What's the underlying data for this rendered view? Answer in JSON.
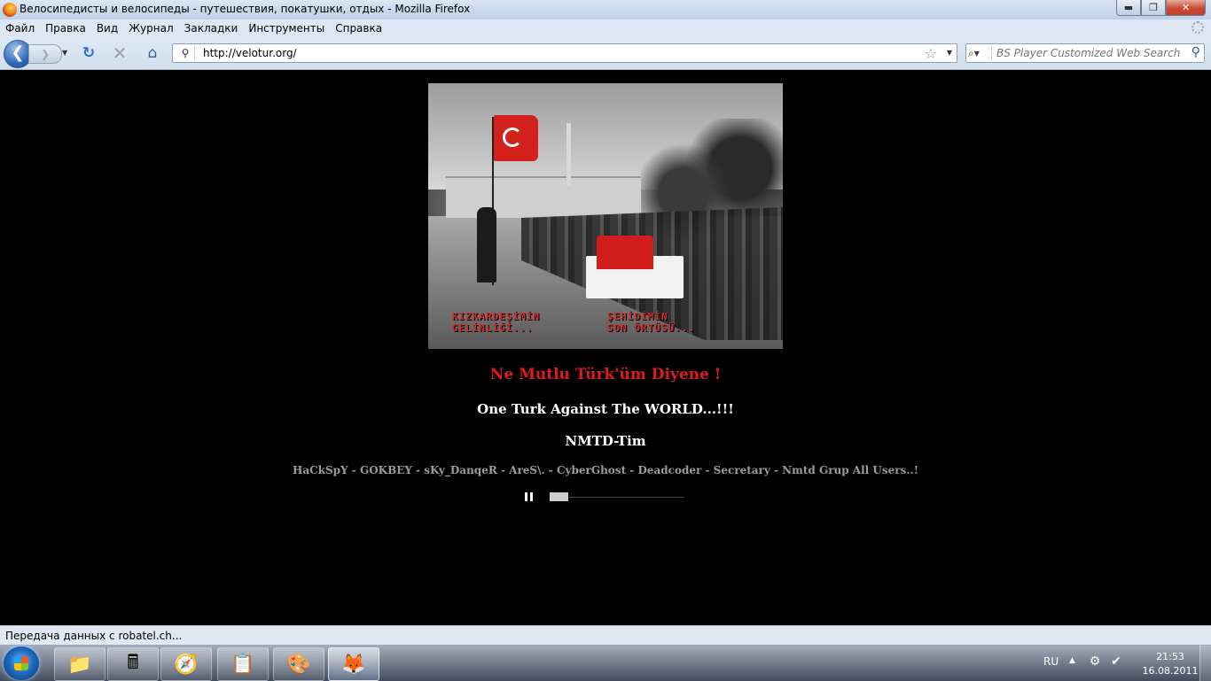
{
  "window": {
    "title": "Велосипедисты и велосипеды - путешествия, покатушки, отдых - Mozilla Firefox",
    "minimize": "▬",
    "maximize": "❐",
    "close": "✕"
  },
  "menu": {
    "items": [
      "Файл",
      "Правка",
      "Вид",
      "Журнал",
      "Закладки",
      "Инструменты",
      "Справка"
    ]
  },
  "toolbar": {
    "back": "❮",
    "forward": "❯",
    "url": "http://velotur.org/",
    "site_icon": "bicycle-icon",
    "search_placeholder": "BS Player Customized Web Search"
  },
  "page": {
    "image_caption_left": "KIZKARDEŞİMİN\nGELİNLİĞİ...",
    "image_caption_right": "ŞEHİDİMİN\nSON ÖRTÜSÜ...",
    "line1": "Ne Mutlu Türk'üm Diyene !",
    "line2": "One Turk Against The WORLD...!!!",
    "line3": "NMTD-Tim",
    "line4": "HaCkSpY - GOKBEY - sKy_DanqeR - AreS\\. - CyberGhost - Deadcoder - Secretary - Nmtd Grup All Users..!",
    "player_progress": 0.14
  },
  "status": {
    "text": "Передача данных с robatel.ch..."
  },
  "taskbar": {
    "lang": "RU",
    "time": "21:53",
    "date": "16.08.2011",
    "apps": [
      "explorer-icon",
      "calculator-icon",
      "safari-icon",
      "notes-icon",
      "paint-icon",
      "firefox-icon"
    ]
  },
  "colors": {
    "headline_red": "#e01b1b",
    "page_bg": "#000000",
    "members_gray": "#9b9b9b"
  }
}
